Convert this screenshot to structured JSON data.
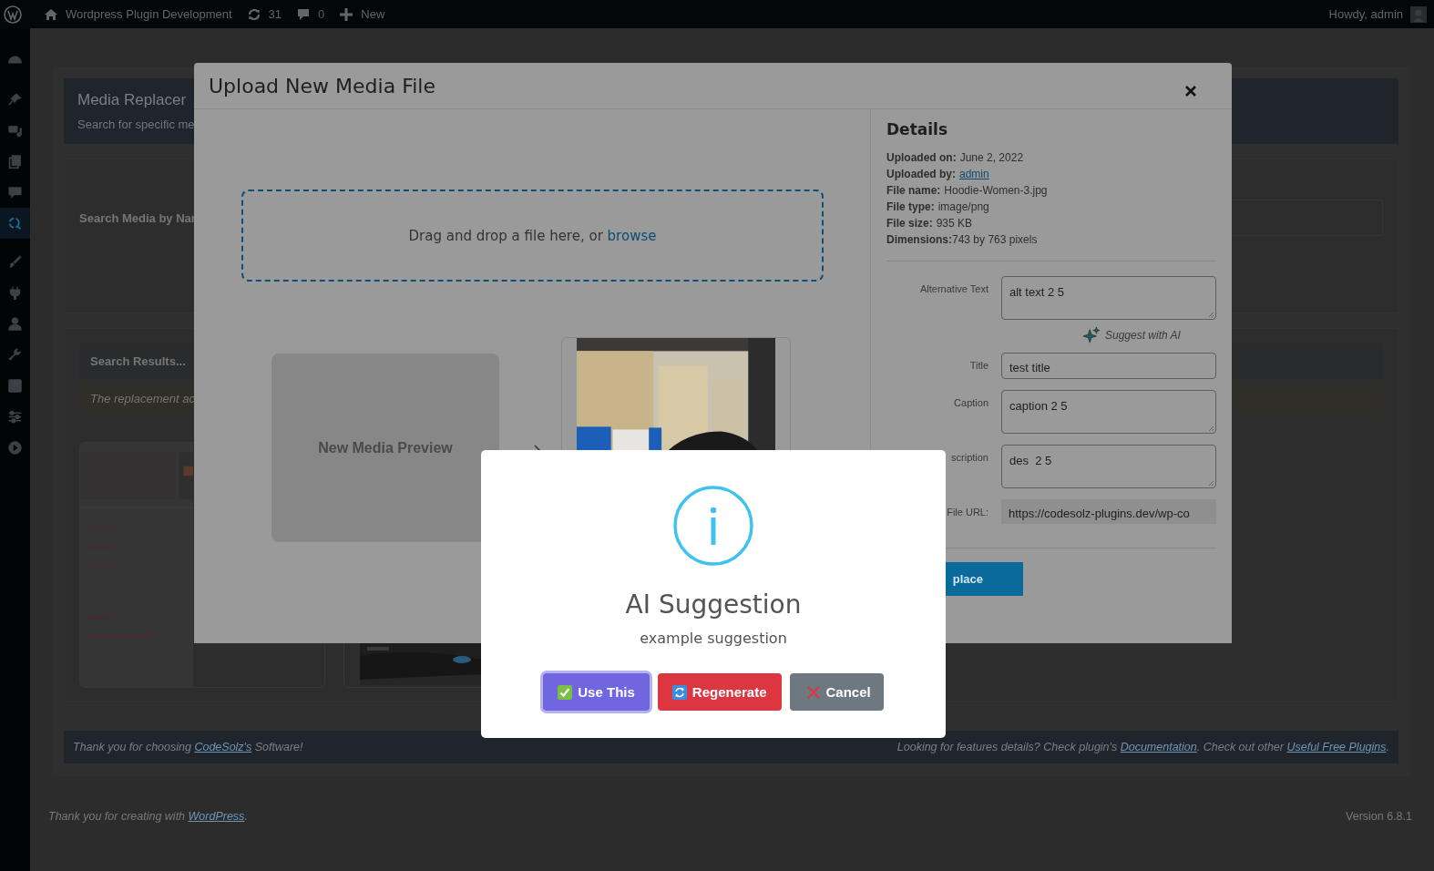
{
  "admin_bar": {
    "site_title": "Wordpress Plugin Development",
    "updates_count": "31",
    "comments_count": "0",
    "new_label": "New",
    "greeting": "Howdy, admin"
  },
  "sidebar_items": [
    {
      "selected": false
    },
    {
      "selected": false
    },
    {
      "selected": false
    },
    {
      "selected": false
    },
    {
      "selected": false
    },
    {
      "selected": true
    },
    {
      "selected": false
    },
    {
      "selected": false
    },
    {
      "selected": false
    },
    {
      "selected": false
    },
    {
      "selected": false
    },
    {
      "selected": false
    },
    {
      "selected": false
    }
  ],
  "page": {
    "header": {
      "title": "Media Replacer",
      "subtitle": "Search for specific me"
    },
    "search_label": "Search Media by Nar",
    "results": {
      "title": "Search Results...",
      "notice": "The replacement ac"
    },
    "footer_bar": {
      "left": {
        "before": "Thank you for choosing ",
        "link": "CodeSolz's",
        "after": " Software!"
      },
      "right": {
        "before": "Looking for features details? Check plugin's ",
        "link1": "Documentation",
        "middle": ". Check out other ",
        "link2": "Useful Free Plugins",
        "after": "."
      }
    }
  },
  "wp_footer": {
    "before": "Thank you for creating with ",
    "link": "WordPress",
    "after": ".",
    "version": "Version 6.8.1"
  },
  "upload_modal": {
    "title": "Upload New Media File",
    "dropzone": {
      "text": "Drag and drop a file here, or ",
      "link": "browse"
    },
    "new_preview_label": "New Media Preview",
    "details": {
      "title": "Details",
      "meta": [
        {
          "label": "Uploaded on:",
          "value": "June 2, 2022",
          "kind": "text"
        },
        {
          "label": "Uploaded by:",
          "value": "admin",
          "kind": "link"
        },
        {
          "label": "File name:",
          "value": "Hoodie-Women-3.jpg",
          "kind": "text"
        },
        {
          "label": "File type:",
          "value": "image/png",
          "kind": "text"
        },
        {
          "label": "File size:",
          "value": "935 KB",
          "kind": "text"
        },
        {
          "label": "Dimensions:",
          "value": "743 by 763 pixels",
          "kind": "tight"
        }
      ],
      "fields": [
        {
          "label": "Alternative Text",
          "value": "alt text 2 5",
          "kind": "textarea",
          "action": "Suggest with AI"
        },
        {
          "label": "Title",
          "value": "test title",
          "kind": "input"
        },
        {
          "label": "Caption",
          "value": "caption 2 5",
          "kind": "textarea"
        },
        {
          "label": "scription",
          "value": "des  2 5",
          "kind": "textarea"
        },
        {
          "label": "File URL:",
          "value": "https://codesolz-plugins.dev/wp-co",
          "kind": "readonly"
        }
      ],
      "replace_button": "place"
    }
  },
  "alert": {
    "title": "AI Suggestion",
    "text": "example suggestion",
    "buttons": [
      {
        "label": "Use This",
        "kind": "confirm",
        "focused": true
      },
      {
        "label": "Regenerate",
        "kind": "deny",
        "focused": false
      },
      {
        "label": "Cancel",
        "kind": "cancel",
        "focused": false
      }
    ]
  }
}
